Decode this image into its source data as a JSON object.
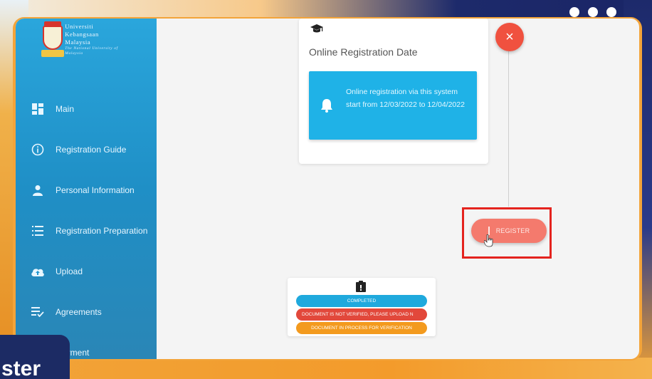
{
  "university": {
    "line1": "Universiti",
    "line2": "Kebangsaan",
    "line3": "Malaysia",
    "tagline": "The National University of Malaysia"
  },
  "sidebar": {
    "items": [
      {
        "label": "Main",
        "icon": "dashboard-icon"
      },
      {
        "label": "Registration Guide",
        "icon": "info-circle-icon"
      },
      {
        "label": "Personal Information",
        "icon": "person-icon"
      },
      {
        "label": "Registration Preparation",
        "icon": "list-icon"
      },
      {
        "label": "Upload",
        "icon": "cloud-upload-icon"
      },
      {
        "label": "Agreements",
        "icon": "checklist-icon"
      },
      {
        "label": "Payment",
        "icon": "payment-icon"
      }
    ]
  },
  "date_card": {
    "title": "Online Registration Date",
    "message": "Online registration via this system start from 12/03/2022 to 12/04/2022"
  },
  "actions": {
    "close_symbol": "×",
    "register_label": "REGISTER"
  },
  "status_legend": [
    {
      "label": "COMPLETED",
      "color": "#1fa9dd"
    },
    {
      "label": "DOCUMENT IS NOT VERIFIED, PLEASE UPLOAD N",
      "color": "#e2483b"
    },
    {
      "label": "DOCUMENT IN PROCESS FOR VERIFICATION",
      "color": "#f39a1e"
    }
  ],
  "overlay": {
    "text": "ster"
  },
  "colors": {
    "sidebar": "#1f9ad3",
    "info_box": "#1fb2e7",
    "close_button": "#f0513f",
    "register_button": "#f47a6d",
    "highlight": "#e4231e"
  }
}
